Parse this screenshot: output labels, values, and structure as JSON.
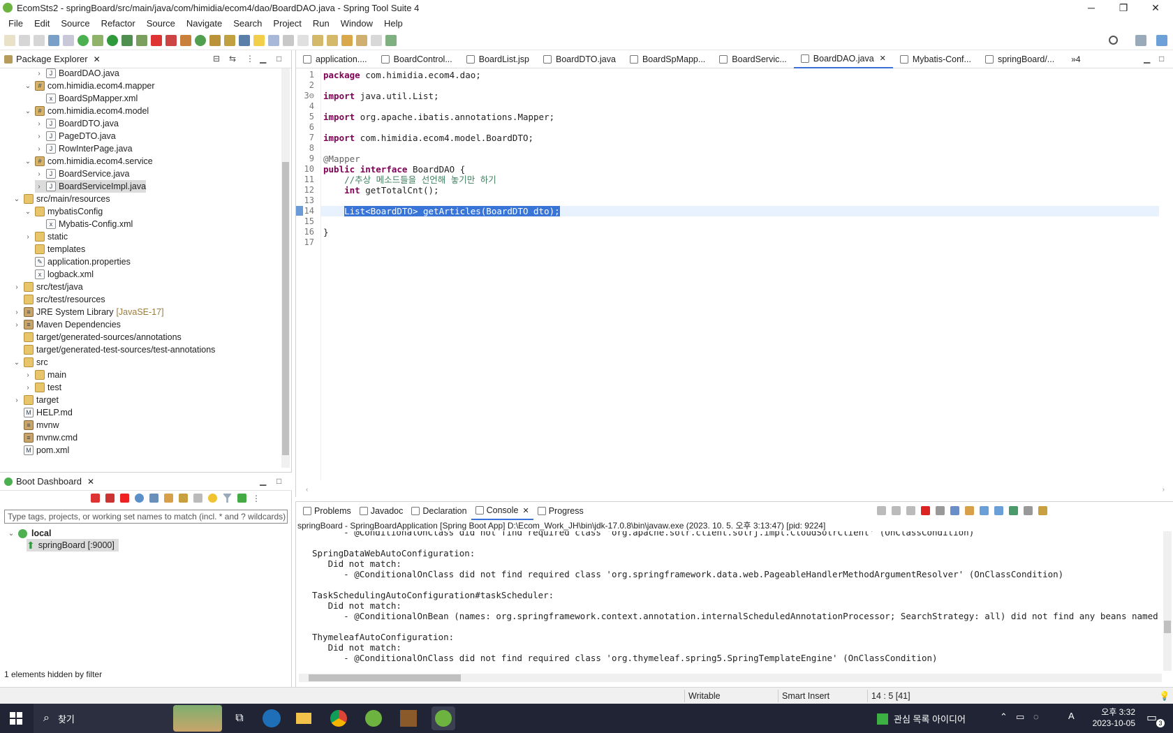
{
  "window": {
    "title": "EcomSts2 - springBoard/src/main/java/com/himidia/ecom4/dao/BoardDAO.java - Spring Tool Suite 4",
    "minimize": "─",
    "maximize": "❐",
    "close": "✕"
  },
  "menu": [
    "File",
    "Edit",
    "Source",
    "Refactor",
    "Source",
    "Navigate",
    "Search",
    "Project",
    "Run",
    "Window",
    "Help"
  ],
  "package_explorer": {
    "title": "Package Explorer",
    "tree": [
      {
        "label": "BoardDAO.java",
        "twisty": "›",
        "icon": "J"
      },
      {
        "label": "com.himidia.ecom4.mapper",
        "twisty": "⌄",
        "icon": "#"
      },
      {
        "label": "BoardSpMapper.xml",
        "twisty": "",
        "icon": "x"
      },
      {
        "label": "com.himidia.ecom4.model",
        "twisty": "⌄",
        "icon": "#"
      },
      {
        "label": "BoardDTO.java",
        "twisty": "›",
        "icon": "J"
      },
      {
        "label": "PageDTO.java",
        "twisty": "›",
        "icon": "J"
      },
      {
        "label": "RowInterPage.java",
        "twisty": "›",
        "icon": "J"
      },
      {
        "label": "com.himidia.ecom4.service",
        "twisty": "⌄",
        "icon": "#"
      },
      {
        "label": "BoardService.java",
        "twisty": "›",
        "icon": "J"
      },
      {
        "label": "BoardServiceImpl.java",
        "twisty": "›",
        "icon": "J"
      },
      {
        "label": "src/main/resources",
        "twisty": "⌄",
        "icon": ""
      },
      {
        "label": "mybatisConfig",
        "twisty": "⌄",
        "icon": ""
      },
      {
        "label": "Mybatis-Config.xml",
        "twisty": "",
        "icon": "x"
      },
      {
        "label": "static",
        "twisty": "›",
        "icon": ""
      },
      {
        "label": "templates",
        "twisty": "",
        "icon": ""
      },
      {
        "label": "application.properties",
        "twisty": "",
        "icon": "✎"
      },
      {
        "label": "logback.xml",
        "twisty": "",
        "icon": "x"
      },
      {
        "label": "src/test/java",
        "twisty": "›",
        "icon": ""
      },
      {
        "label": "src/test/resources",
        "twisty": "",
        "icon": ""
      },
      {
        "label": "JRE System Library",
        "suffix": "[JavaSE-17]",
        "twisty": "›",
        "icon": "≡"
      },
      {
        "label": "Maven Dependencies",
        "twisty": "›",
        "icon": "≡"
      },
      {
        "label": "target/generated-sources/annotations",
        "twisty": "",
        "icon": ""
      },
      {
        "label": "target/generated-test-sources/test-annotations",
        "twisty": "",
        "icon": ""
      },
      {
        "label": "src",
        "twisty": "⌄",
        "icon": ""
      },
      {
        "label": "main",
        "twisty": "›",
        "icon": ""
      },
      {
        "label": "test",
        "twisty": "›",
        "icon": ""
      },
      {
        "label": "target",
        "twisty": "›",
        "icon": ""
      },
      {
        "label": "HELP.md",
        "twisty": "",
        "icon": "M"
      },
      {
        "label": "mvnw",
        "twisty": "",
        "icon": "≡"
      },
      {
        "label": "mvnw.cmd",
        "twisty": "",
        "icon": "≡"
      },
      {
        "label": "pom.xml",
        "twisty": "",
        "icon": "M"
      }
    ]
  },
  "boot_dashboard": {
    "title": "Boot Dashboard",
    "filter_placeholder": "Type tags, projects, or working set names to match (incl. * and ? wildcards)",
    "local": "local",
    "app": "springBoard [:9000]",
    "footer": "1 elements hidden by filter"
  },
  "editor": {
    "tabs": [
      "application....",
      "BoardControl...",
      "BoardList.jsp",
      "BoardDTO.java",
      "BoardSpMapp...",
      "BoardServic...",
      "BoardDAO.java",
      "Mybatis-Conf...",
      "springBoard/..."
    ],
    "active_tab": 6,
    "overflow": "»4",
    "lines": [
      {
        "n": "1",
        "text": "package com.himidia.ecom4.dao;"
      },
      {
        "n": "2",
        "text": ""
      },
      {
        "n": "3⊖",
        "text": "import java.util.List;"
      },
      {
        "n": "4",
        "text": ""
      },
      {
        "n": "5",
        "text": "import org.apache.ibatis.annotations.Mapper;"
      },
      {
        "n": "6",
        "text": ""
      },
      {
        "n": "7",
        "text": "import com.himidia.ecom4.model.BoardDTO;"
      },
      {
        "n": "8",
        "text": ""
      },
      {
        "n": "9",
        "text": "@Mapper"
      },
      {
        "n": "10",
        "text": "public interface BoardDAO {"
      },
      {
        "n": "11",
        "text": "    //추상 메소드들을 선언해 놓기만 하기"
      },
      {
        "n": "12",
        "text": "    int getTotalCnt();"
      },
      {
        "n": "13",
        "text": ""
      },
      {
        "n": "14",
        "text": "    List<BoardDTO> getArticles(BoardDTO dto);"
      },
      {
        "n": "15",
        "text": ""
      },
      {
        "n": "16",
        "text": "}"
      },
      {
        "n": "17",
        "text": ""
      }
    ]
  },
  "console": {
    "tabs": [
      "Problems",
      "Javadoc",
      "Declaration",
      "Console",
      "Progress"
    ],
    "active_tab": 3,
    "path": "springBoard - SpringBoardApplication [Spring Boot App] D:\\Ecom_Work_JH\\bin\\jdk-17.0.8\\bin\\javaw.exe  (2023. 10. 5. 오후 3:13:47) [pid: 9224]",
    "lines": [
      "      - @ConditionalOnClass did not find required class 'org.apache.solr.client.solrj.impl.CloudSolrClient' (OnClassCondition)",
      "",
      "SpringDataWebAutoConfiguration:",
      "   Did not match:",
      "      - @ConditionalOnClass did not find required class 'org.springframework.data.web.PageableHandlerMethodArgumentResolver' (OnClassCondition)",
      "",
      "TaskSchedulingAutoConfiguration#taskScheduler:",
      "   Did not match:",
      "      - @ConditionalOnBean (names: org.springframework.context.annotation.internalScheduledAnnotationProcessor; SearchStrategy: all) did not find any beans named org.springfr",
      "",
      "ThymeleafAutoConfiguration:",
      "   Did not match:",
      "      - @ConditionalOnClass did not find required class 'org.thymeleaf.spring5.SpringTemplateEngine' (OnClassCondition)"
    ]
  },
  "status": {
    "writable": "Writable",
    "insert": "Smart Insert",
    "position": "14 : 5 [41]"
  },
  "taskbar": {
    "search": "찾기",
    "notice": "관심 목록 아이디어",
    "time": "오후 3:32",
    "date": "2023-10-05",
    "ime": "A",
    "badge": "3"
  }
}
